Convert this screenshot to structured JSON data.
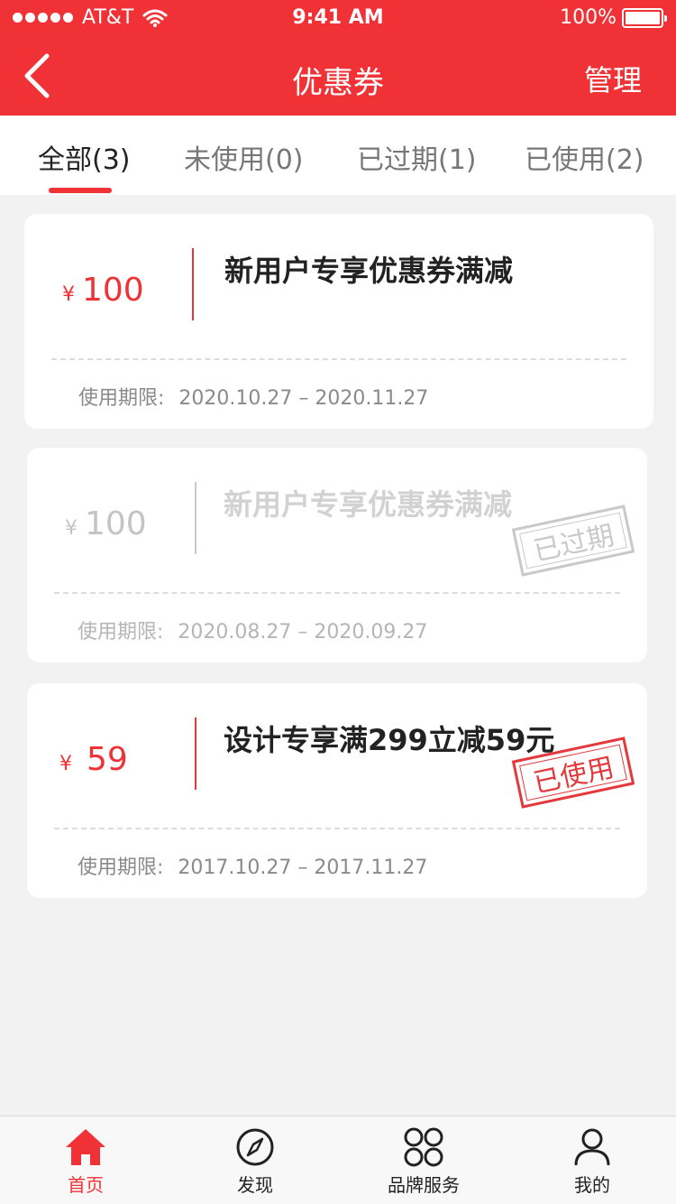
{
  "status_bar": {
    "carrier": "AT&T",
    "time": "9:41 AM",
    "battery": "100%"
  },
  "nav": {
    "title": "优惠券",
    "manage_label": "管理"
  },
  "tabs": [
    {
      "label": "全部(3)",
      "active": true
    },
    {
      "label": "未使用(0)",
      "active": false
    },
    {
      "label": "已过期(1)",
      "active": false
    },
    {
      "label": "已使用(2)",
      "active": false
    }
  ],
  "coupons": [
    {
      "currency": "¥",
      "amount": "100",
      "title": "新用户专享优惠券满减",
      "period_label": "使用期限:",
      "period": "2020.10.27 – 2020.11.27",
      "state": "normal",
      "stamp": ""
    },
    {
      "currency": "¥",
      "amount": "100",
      "title": "新用户专享优惠券满减",
      "period_label": "使用期限:",
      "period": "2020.08.27 – 2020.09.27",
      "state": "expired",
      "stamp": "已过期"
    },
    {
      "currency": "¥",
      "amount": "59",
      "title": "设计专享满299立减59元",
      "period_label": "使用期限:",
      "period": "2017.10.27 – 2017.11.27",
      "state": "used",
      "stamp": "已使用"
    }
  ],
  "tabbar": [
    {
      "label": "首页",
      "icon": "home-icon",
      "active": true
    },
    {
      "label": "发现",
      "icon": "compass-icon",
      "active": false
    },
    {
      "label": "品牌服务",
      "icon": "clover-grid-icon",
      "active": false
    },
    {
      "label": "我的",
      "icon": "user-icon",
      "active": false
    }
  ],
  "colors": {
    "primary": "#f03236",
    "background": "#f2f2f2",
    "muted": "#c4c4c4"
  }
}
